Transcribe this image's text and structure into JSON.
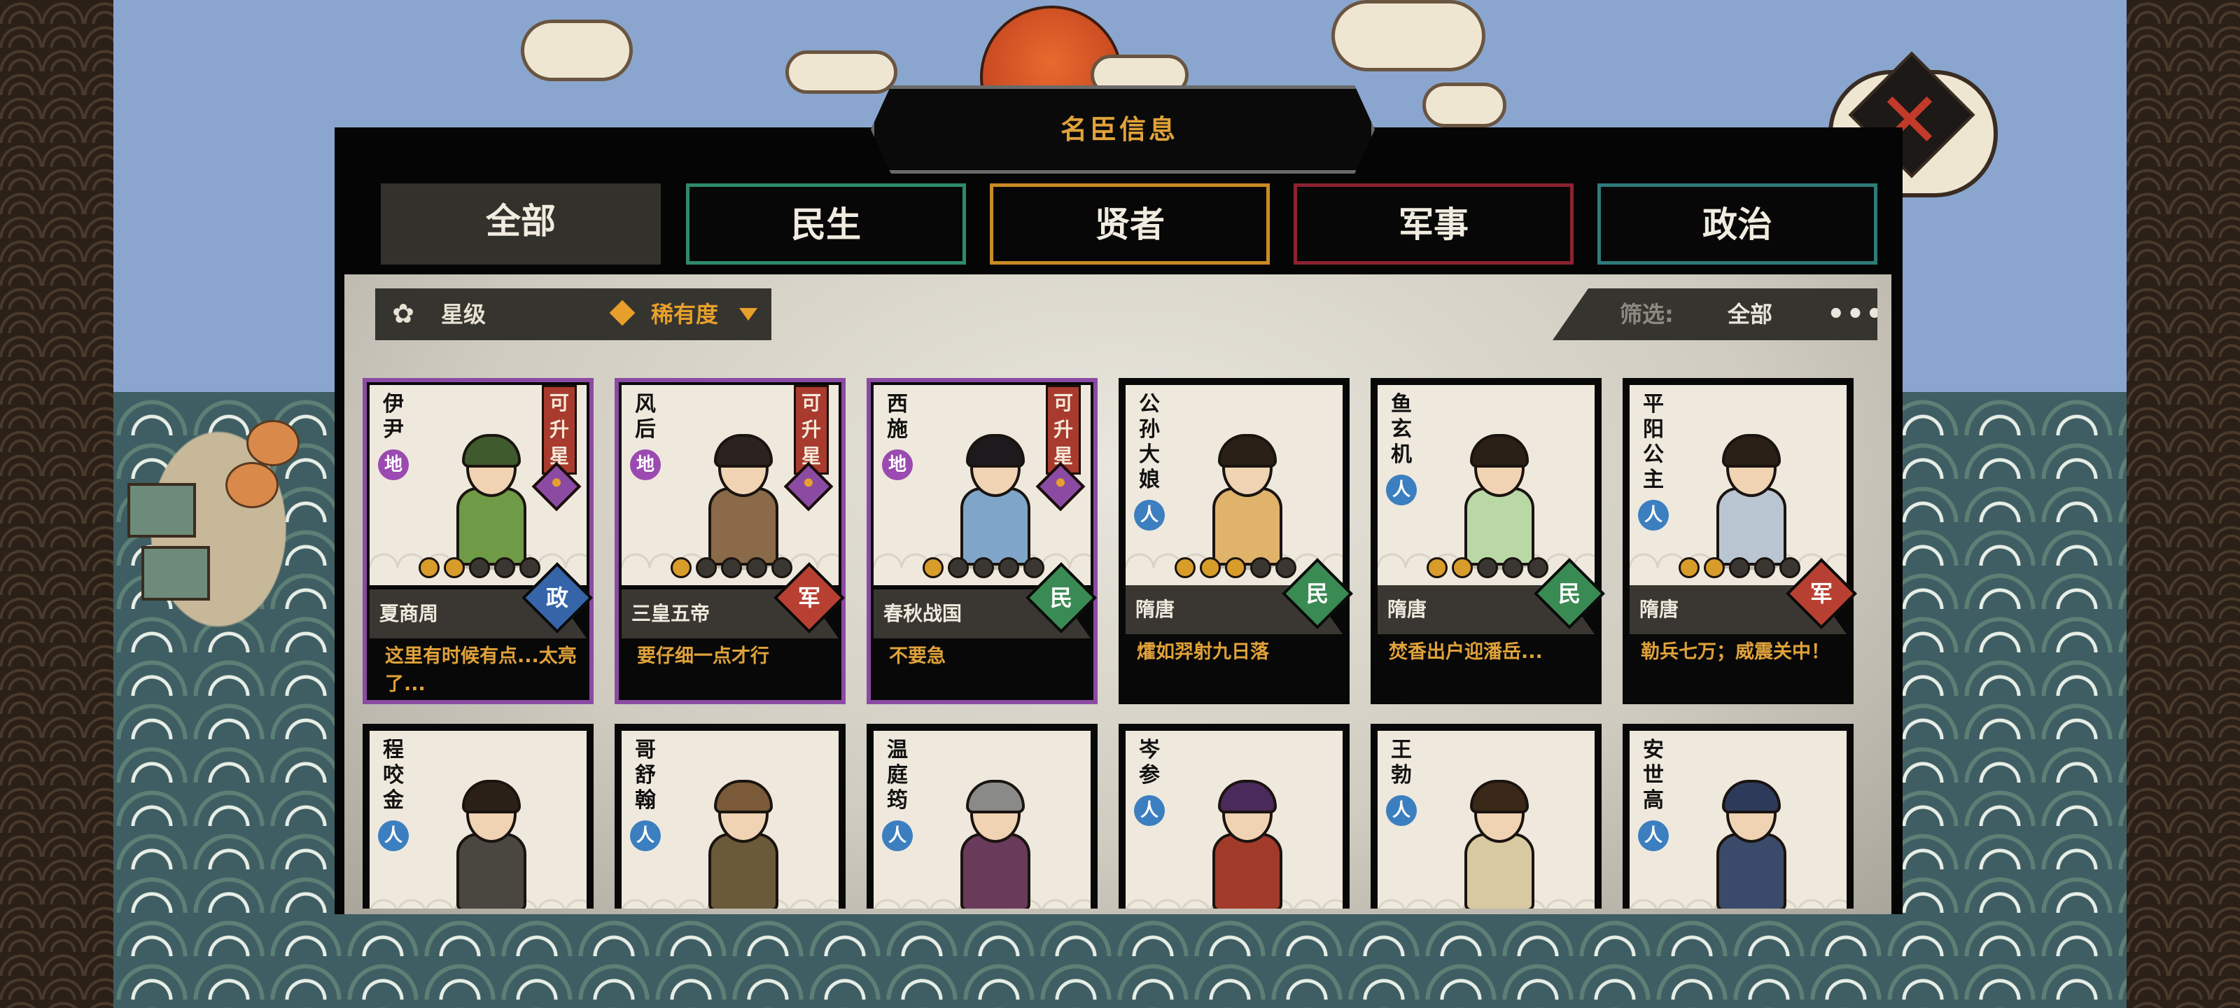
{
  "window_title": "名臣信息",
  "tabs": [
    {
      "label": "全部",
      "active": true
    },
    {
      "label": "民生",
      "color": "#2f8a6d"
    },
    {
      "label": "贤者",
      "color": "#c98a27"
    },
    {
      "label": "军事",
      "color": "#8c2230"
    },
    {
      "label": "政治",
      "color": "#2f7a7a"
    }
  ],
  "filters": {
    "star_label": "星级",
    "rarity_label": "稀有度",
    "screen_label": "筛选:",
    "screen_value": "全部",
    "more": "•••"
  },
  "upgrade_text": "可升星",
  "cards": [
    {
      "name": "伊尹",
      "rarity": "地",
      "rarity_type": "earth",
      "upgradable": true,
      "stars": 2,
      "max_stars": 5,
      "era": "夏商周",
      "category": "政",
      "category_type": "politics",
      "quote": "这里有时候有点...太亮了...",
      "hair": "#3f5a2c",
      "body": "#6f9a46"
    },
    {
      "name": "风后",
      "rarity": "地",
      "rarity_type": "earth",
      "upgradable": true,
      "stars": 1,
      "max_stars": 5,
      "era": "三皇五帝",
      "category": "军",
      "category_type": "military",
      "quote": "要仔细一点才行",
      "hair": "#2a2320",
      "body": "#8a6a48"
    },
    {
      "name": "西施",
      "rarity": "地",
      "rarity_type": "earth",
      "upgradable": true,
      "stars": 1,
      "max_stars": 5,
      "era": "春秋战国",
      "category": "民",
      "category_type": "people",
      "quote": "不要急",
      "hair": "#1c1a1c",
      "body": "#7fa6c8"
    },
    {
      "name": "公孙大娘",
      "rarity": "人",
      "rarity_type": "human",
      "upgradable": false,
      "stars": 3,
      "max_stars": 5,
      "era": "隋唐",
      "category": "民",
      "category_type": "people",
      "quote": "㸌如羿射九日落",
      "hair": "#2a2018",
      "body": "#e0b36a"
    },
    {
      "name": "鱼玄机",
      "rarity": "人",
      "rarity_type": "human",
      "upgradable": false,
      "stars": 2,
      "max_stars": 5,
      "era": "隋唐",
      "category": "民",
      "category_type": "people",
      "quote": "焚香出户迎潘岳...",
      "hair": "#2a2018",
      "body": "#b9d8a6"
    },
    {
      "name": "平阳公主",
      "rarity": "人",
      "rarity_type": "human",
      "upgradable": false,
      "stars": 2,
      "max_stars": 5,
      "era": "隋唐",
      "category": "军",
      "category_type": "military",
      "quote": "勒兵七万；威震关中！",
      "hair": "#2a2018",
      "body": "#b9c6d2"
    },
    {
      "name": "程咬金",
      "rarity": "人",
      "rarity_type": "human",
      "hair": "#2a2018",
      "body": "#4a4640"
    },
    {
      "name": "哥舒翰",
      "rarity": "人",
      "rarity_type": "human",
      "hair": "#7a5a38",
      "body": "#6a5a3a"
    },
    {
      "name": "温庭筠",
      "rarity": "人",
      "rarity_type": "human",
      "hair": "#8a8a88",
      "body": "#6a3a5a"
    },
    {
      "name": "岑参",
      "rarity": "人",
      "rarity_type": "human",
      "hair": "#4a2a5a",
      "body": "#a23a2a"
    },
    {
      "name": "王勃",
      "rarity": "人",
      "rarity_type": "human",
      "hair": "#3a2818",
      "body": "#d8c9a0"
    },
    {
      "name": "安世高",
      "rarity": "人",
      "rarity_type": "human",
      "hair": "#2e3a5a",
      "body": "#3a4a6a"
    }
  ]
}
